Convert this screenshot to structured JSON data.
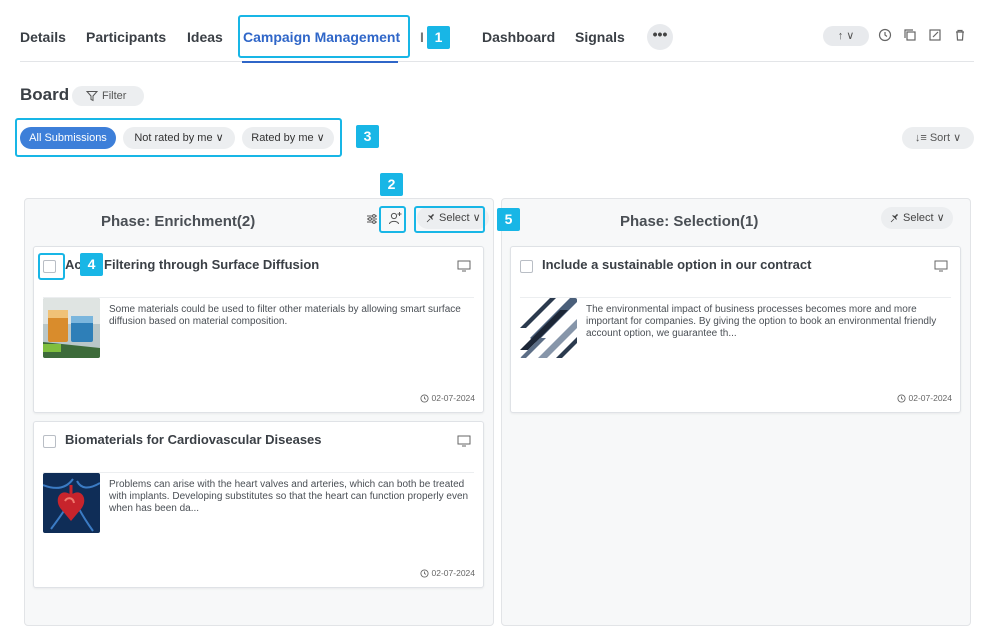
{
  "tabs": [
    {
      "label": "Details"
    },
    {
      "label": "Participants"
    },
    {
      "label": "Ideas"
    },
    {
      "label": "Campaign Management"
    },
    {
      "label": "I"
    },
    {
      "label": "Dashboard"
    },
    {
      "label": "Signals"
    }
  ],
  "toolbar": {
    "more_label": "•••",
    "export_label": "↑ ∨"
  },
  "board": {
    "title": "Board",
    "filter_label": "Filter",
    "sort_label": "↓≡ Sort ∨"
  },
  "filter_chips": [
    {
      "label": "All Submissions"
    },
    {
      "label": "Not rated by me ∨"
    },
    {
      "label": "Rated by me ∨"
    }
  ],
  "columns": [
    {
      "title": "Phase: Enrichment(2)",
      "select_label": "Select ∨",
      "cards": [
        {
          "title": "Ac    ed Filtering through Surface Diffusion",
          "description": "Some materials could be used to filter other materials by allowing smart surface diffusion based on material composition.",
          "date": "02-07-2024",
          "thumb": "lab-flasks-image"
        },
        {
          "title": "Biomaterials for Cardiovascular Diseases",
          "description": "Problems can arise with the heart valves and arteries, which can both be treated with implants. Developing substitutes so that the heart can function properly even when has been da...",
          "date": "02-07-2024",
          "thumb": "heart-image"
        }
      ]
    },
    {
      "title": "Phase: Selection(1)",
      "select_label": "Select ∨",
      "cards": [
        {
          "title": "Include a sustainable option in our contract",
          "description": "The environmental impact of business processes becomes more and more important for companies. By giving the option to book an environmental friendly account option, we guarantee th...",
          "date": "02-07-2024",
          "thumb": "abstract-stripes-image"
        }
      ]
    }
  ],
  "annotations": [
    "1",
    "2",
    "3",
    "4",
    "5"
  ],
  "colors": {
    "accent": "#2f66c8",
    "chip_active": "#3d7fd9",
    "highlight": "#18b6e6"
  }
}
